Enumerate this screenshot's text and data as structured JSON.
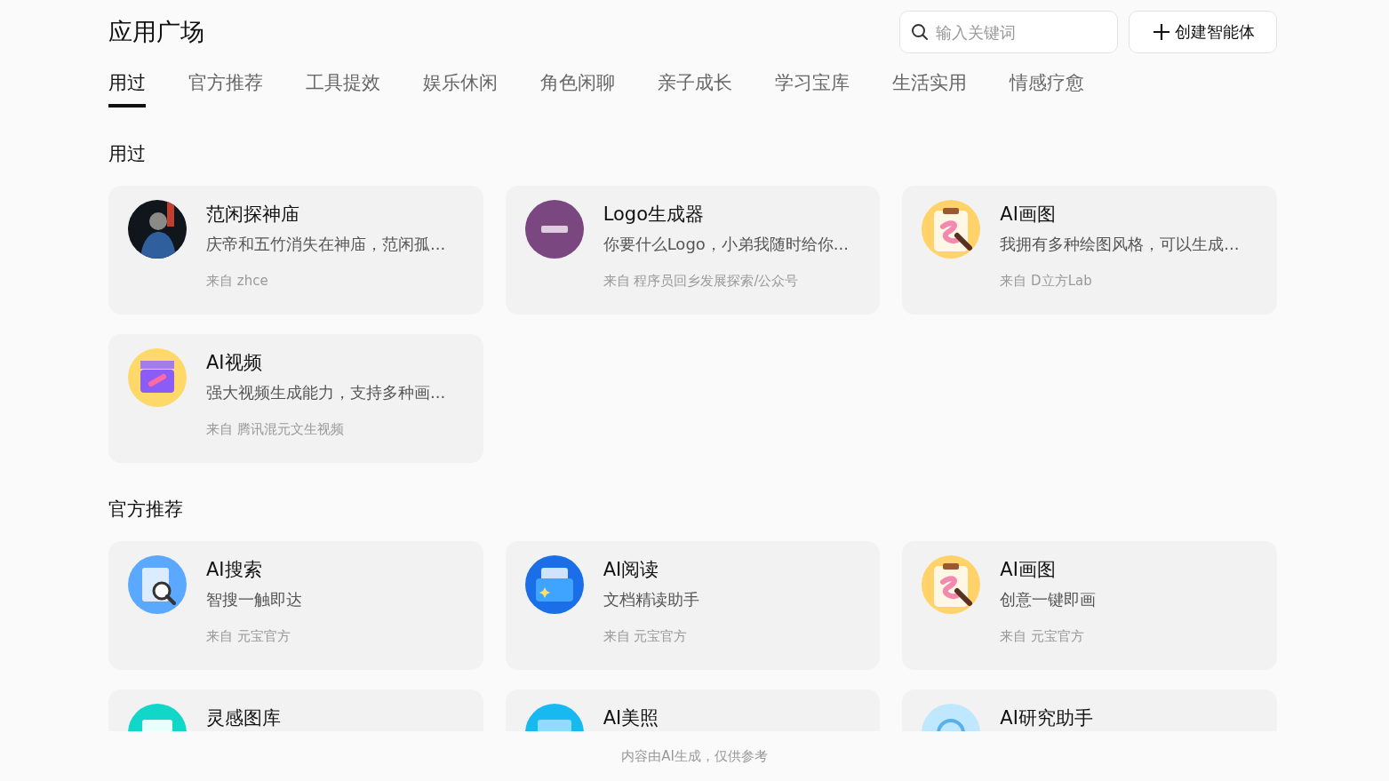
{
  "title": "应用广场",
  "search": {
    "placeholder": "输入关键词"
  },
  "create_button": {
    "label": "创建智能体"
  },
  "tabs": [
    {
      "label": "用过",
      "selected": true
    },
    {
      "label": "官方推荐",
      "selected": false
    },
    {
      "label": "工具提效",
      "selected": false
    },
    {
      "label": "娱乐休闲",
      "selected": false
    },
    {
      "label": "角色闲聊",
      "selected": false
    },
    {
      "label": "亲子成长",
      "selected": false
    },
    {
      "label": "学习宝库",
      "selected": false
    },
    {
      "label": "生活实用",
      "selected": false
    },
    {
      "label": "情感疗愈",
      "selected": false
    }
  ],
  "sections": [
    {
      "heading": "用过",
      "cards": [
        {
          "kind": "portrait",
          "title": "范闲探神庙",
          "description": "庆帝和五竹消失在神庙，范闲孤...",
          "source": "来自 zhce"
        },
        {
          "kind": "logo",
          "title": "Logo生成器",
          "description": "你要什么Logo，小弟我随时给你...",
          "source": "来自 程序员回乡发展探索/公众号"
        },
        {
          "kind": "paint",
          "title": "AI画图",
          "description": "我拥有多种绘图风格，可以生成...",
          "source": "来自 D立方Lab"
        },
        {
          "kind": "video",
          "title": "AI视频",
          "description": "强大视频生成能力，支持多种画...",
          "source": "来自 腾讯混元文生视频"
        }
      ]
    },
    {
      "heading": "官方推荐",
      "cards": [
        {
          "kind": "search",
          "title": "AI搜索",
          "description": "智搜一触即达",
          "source": "来自 元宝官方"
        },
        {
          "kind": "folder",
          "title": "AI阅读",
          "description": "文档精读助手",
          "source": "来自 元宝官方"
        },
        {
          "kind": "paint",
          "title": "AI画图",
          "description": "创意一键即画",
          "source": "来自 元宝官方"
        },
        {
          "kind": "gallery",
          "title": "灵感图库"
        },
        {
          "title": "AI美照"
        },
        {
          "kind": "research",
          "title": "AI研究助手"
        }
      ]
    }
  ],
  "footer": "内容由AI生成，仅供参考"
}
